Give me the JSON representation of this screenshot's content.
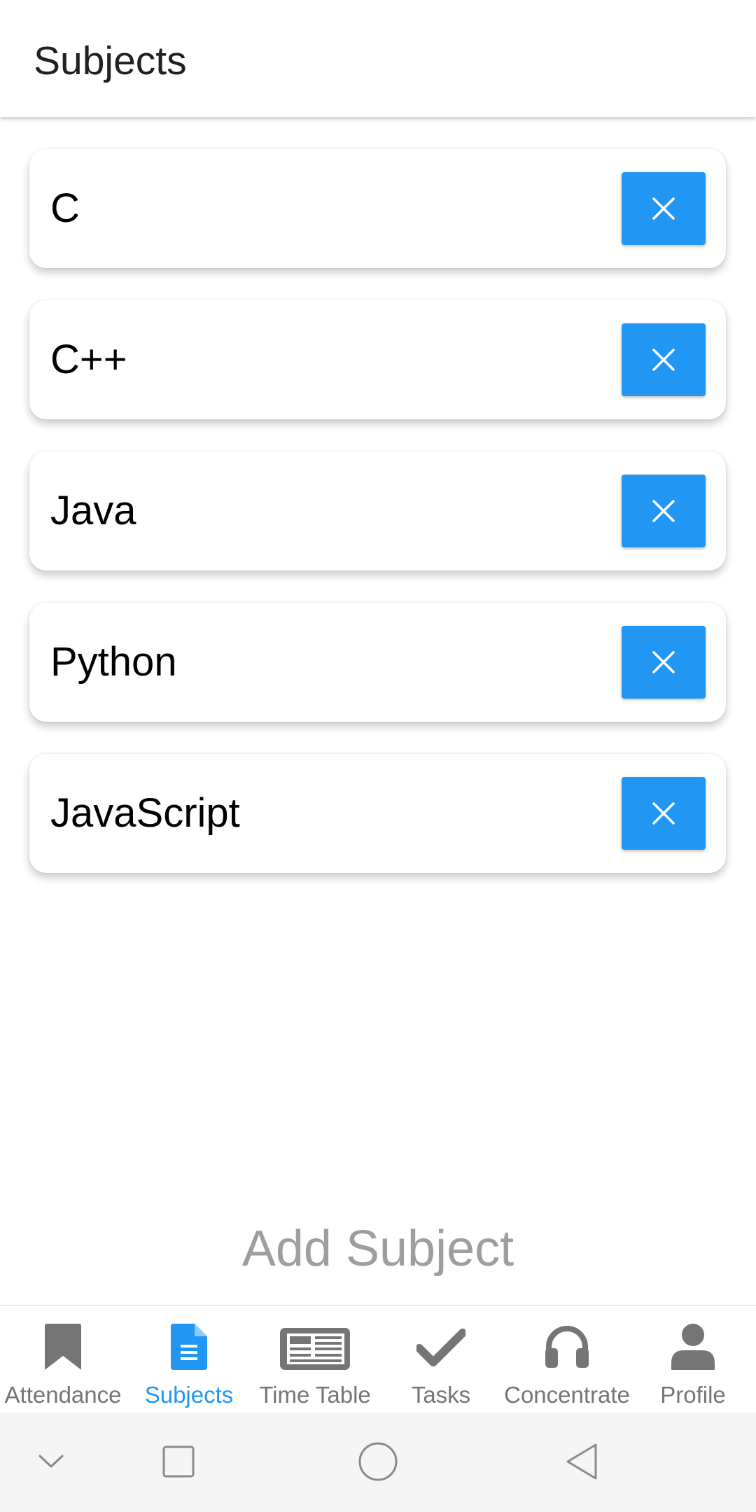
{
  "header": {
    "title": "Subjects"
  },
  "subjects": [
    {
      "name": "C",
      "delete_icon": "close-icon"
    },
    {
      "name": "C++",
      "delete_icon": "close-icon"
    },
    {
      "name": "Java",
      "delete_icon": "close-icon"
    },
    {
      "name": "Python",
      "delete_icon": "close-icon"
    },
    {
      "name": "JavaScript",
      "delete_icon": "close-icon"
    }
  ],
  "add_subject_label": "Add Subject",
  "tabs": [
    {
      "label": "Attendance",
      "icon": "bookmark-icon",
      "active": false
    },
    {
      "label": "Subjects",
      "icon": "document-icon",
      "active": true
    },
    {
      "label": "Time Table",
      "icon": "newspaper-icon",
      "active": false
    },
    {
      "label": "Tasks",
      "icon": "check-icon",
      "active": false
    },
    {
      "label": "Concentrate",
      "icon": "headphones-icon",
      "active": false
    },
    {
      "label": "Profile",
      "icon": "user-icon",
      "active": false
    }
  ],
  "system_nav": [
    {
      "icon": "chevron-down-icon"
    },
    {
      "icon": "recents-square-icon"
    },
    {
      "icon": "home-circle-icon"
    },
    {
      "icon": "back-triangle-icon"
    }
  ],
  "colors": {
    "accent": "#2196f3",
    "tab_inactive": "#757575",
    "add_subject": "#9e9e9e"
  }
}
